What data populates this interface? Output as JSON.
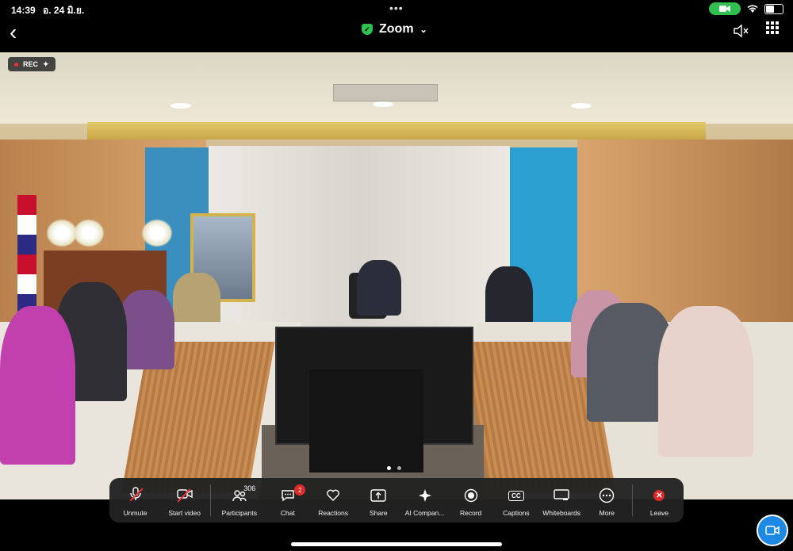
{
  "status_bar": {
    "time": "14:39",
    "date": "อ. 24 มิ.ย.",
    "dots": "•••"
  },
  "header": {
    "title": "Zoom"
  },
  "video": {
    "rec_label": "REC"
  },
  "toolbar": {
    "unmute": "Unmute",
    "start_video": "Start video",
    "participants": "Participants",
    "participants_count": "306",
    "chat": "Chat",
    "chat_badge": "2",
    "reactions": "Reactions",
    "share": "Share",
    "ai_companion": "AI Compan...",
    "record": "Record",
    "captions": "Captions",
    "captions_icon": "CC",
    "whiteboards": "Whiteboards",
    "more": "More",
    "leave": "Leave"
  },
  "colors": {
    "accent": "#1e88e5",
    "leave": "#e02a2a",
    "secure": "#2ec24f"
  }
}
